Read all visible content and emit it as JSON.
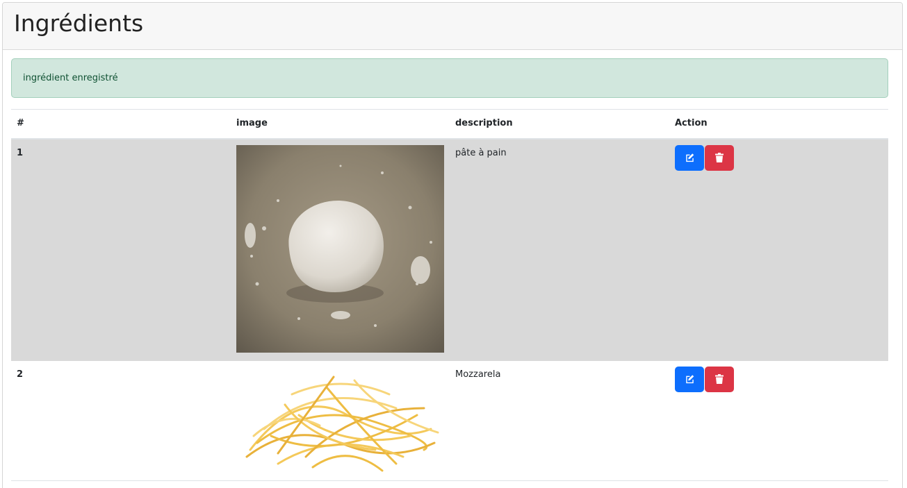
{
  "header": {
    "title": "Ingrédients"
  },
  "alert": {
    "message": "ingrédient enregistré"
  },
  "table": {
    "columns": [
      "#",
      "image",
      "description",
      "Action"
    ],
    "rows": [
      {
        "id": "1",
        "image_alt": "dough ball",
        "description": "pâte à pain"
      },
      {
        "id": "2",
        "image_alt": "shredded mozzarella",
        "description": "Mozzarela"
      }
    ]
  },
  "icons": {
    "edit": "edit-icon",
    "delete": "trash-icon"
  },
  "colors": {
    "primary": "#0d6efd",
    "danger": "#dc3545",
    "alert_bg": "#d1e7dd",
    "highlight_row": "#d9d9d9"
  }
}
